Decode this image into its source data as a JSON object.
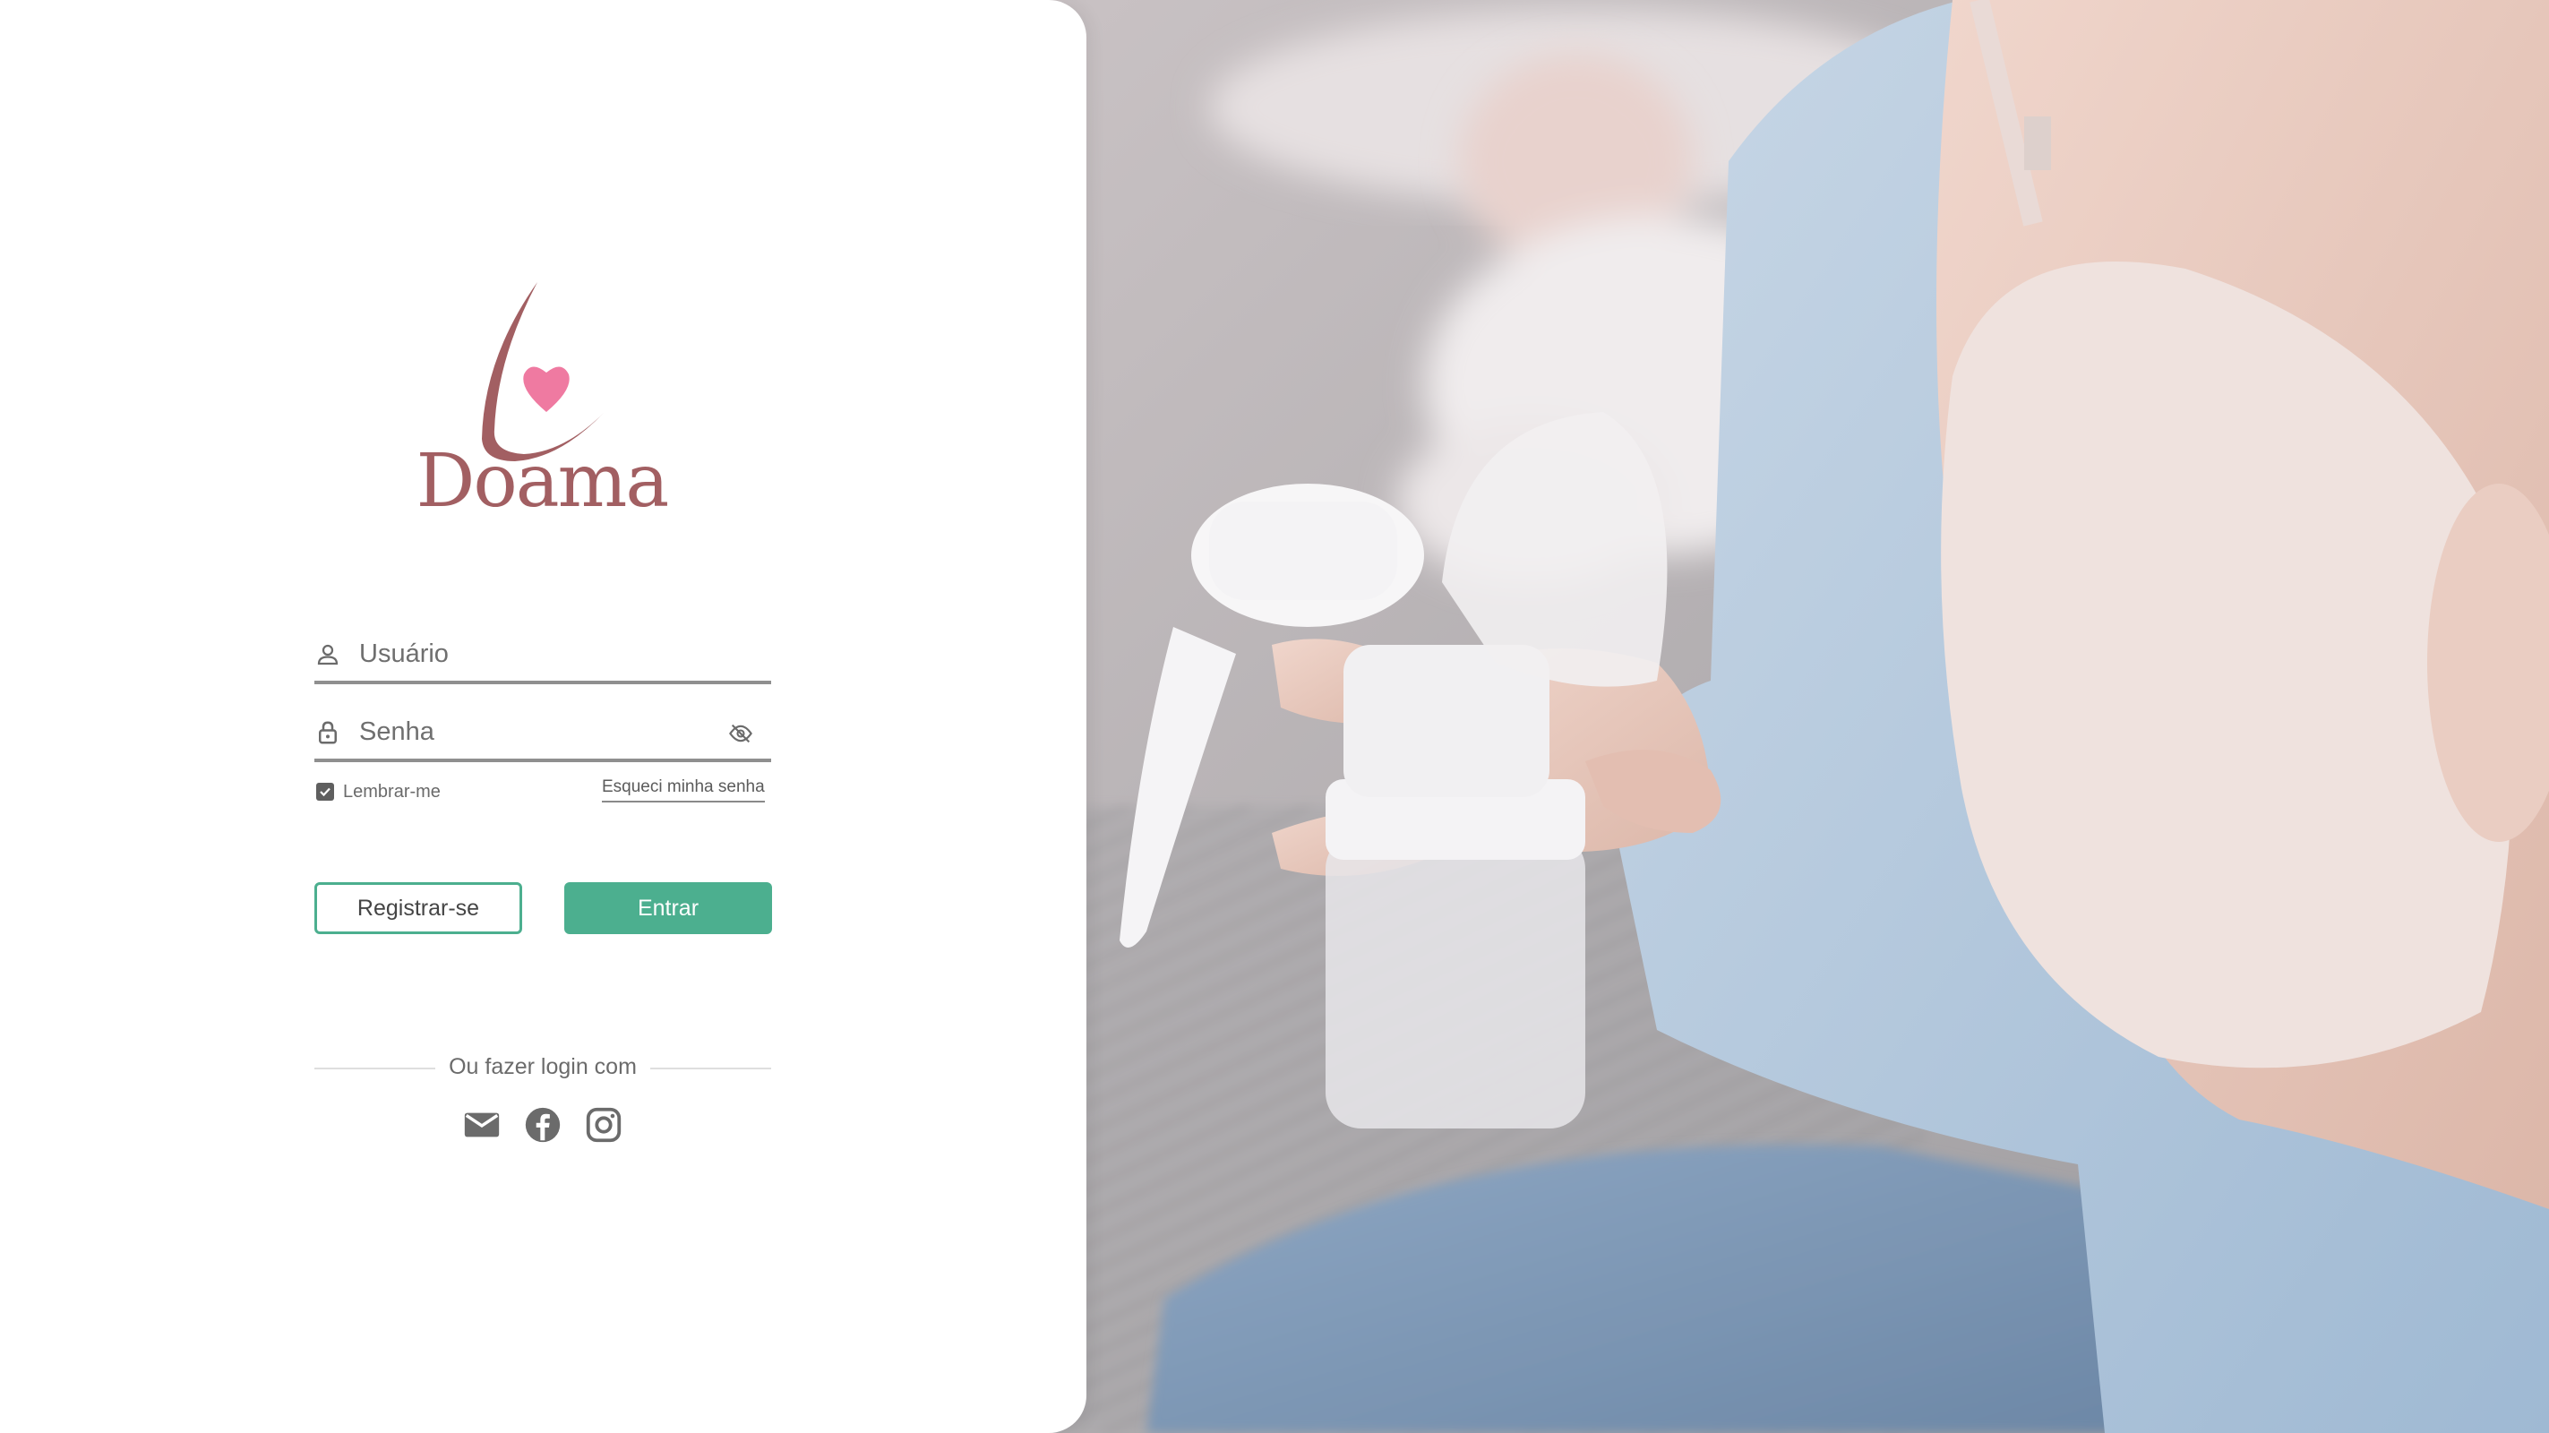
{
  "brand": {
    "name": "Doama",
    "primary_color": "#a25f62",
    "heart_color": "#ef7aa1",
    "accent_color": "#4caf8f"
  },
  "login_form": {
    "username": {
      "placeholder": "Usuário",
      "icon": "user-icon"
    },
    "password": {
      "placeholder": "Senha",
      "icon": "lock-icon",
      "toggle_icon": "eye-off-icon"
    },
    "remember_me": {
      "label": "Lembrar-me",
      "checked": true
    },
    "forgot_password": "Esqueci minha senha",
    "register_button": "Registrar-se",
    "login_button": "Entrar"
  },
  "social_login": {
    "label": "Ou fazer login com",
    "providers": [
      {
        "name": "email",
        "icon": "mail-icon"
      },
      {
        "name": "facebook",
        "icon": "facebook-icon"
      },
      {
        "name": "instagram",
        "icon": "instagram-icon"
      }
    ]
  }
}
